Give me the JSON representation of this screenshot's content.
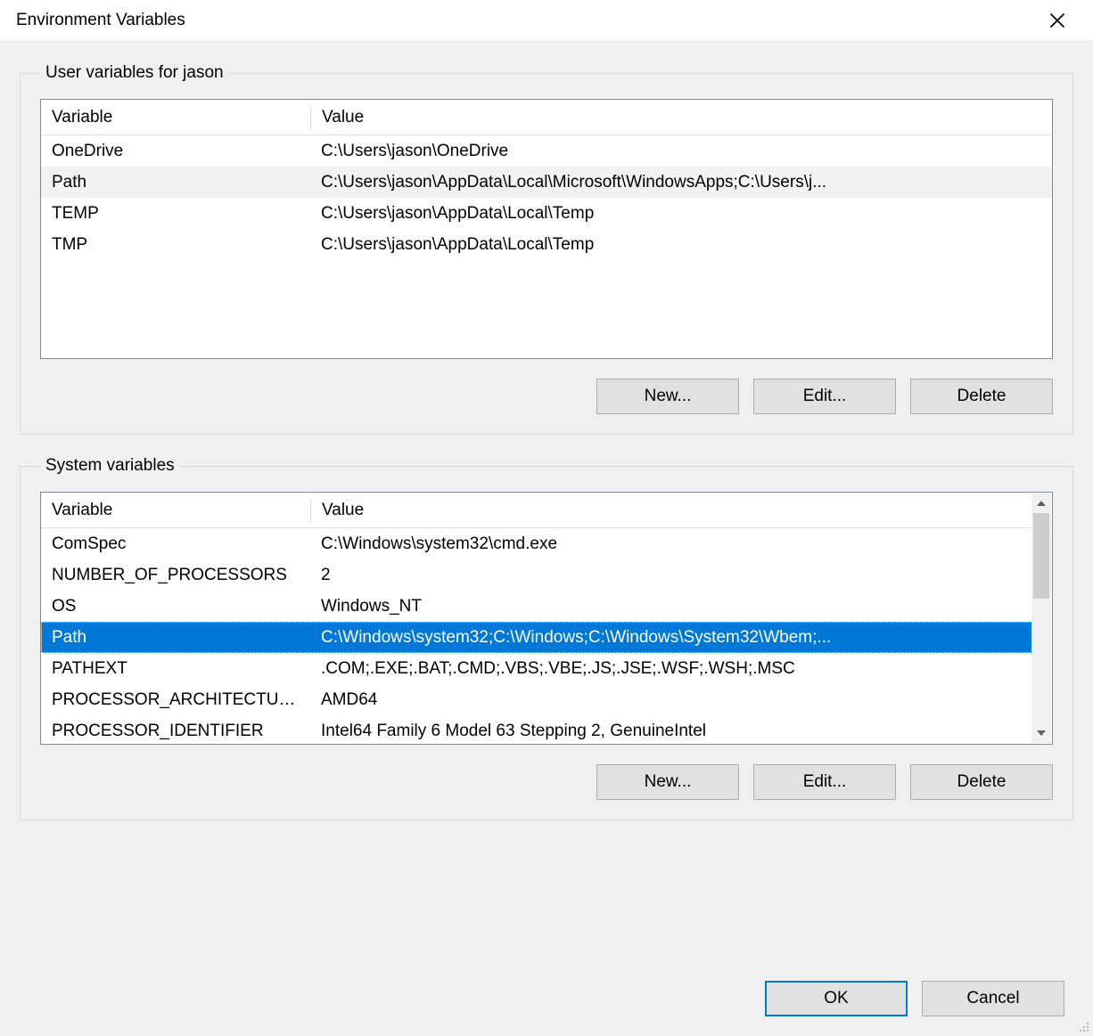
{
  "window": {
    "title": "Environment Variables"
  },
  "columns": {
    "variable": "Variable",
    "value": "Value"
  },
  "user_section": {
    "legend": "User variables for jason",
    "rows": [
      {
        "variable": "OneDrive",
        "value": "C:\\Users\\jason\\OneDrive",
        "selected": false
      },
      {
        "variable": "Path",
        "value": "C:\\Users\\jason\\AppData\\Local\\Microsoft\\WindowsApps;C:\\Users\\j...",
        "selected": "light"
      },
      {
        "variable": "TEMP",
        "value": "C:\\Users\\jason\\AppData\\Local\\Temp",
        "selected": false
      },
      {
        "variable": "TMP",
        "value": "C:\\Users\\jason\\AppData\\Local\\Temp",
        "selected": false
      }
    ],
    "buttons": {
      "new": "New...",
      "edit": "Edit...",
      "delete": "Delete"
    }
  },
  "system_section": {
    "legend": "System variables",
    "rows": [
      {
        "variable": "ComSpec",
        "value": "C:\\Windows\\system32\\cmd.exe",
        "selected": false
      },
      {
        "variable": "NUMBER_OF_PROCESSORS",
        "value": "2",
        "selected": false
      },
      {
        "variable": "OS",
        "value": "Windows_NT",
        "selected": false
      },
      {
        "variable": "Path",
        "value": "C:\\Windows\\system32;C:\\Windows;C:\\Windows\\System32\\Wbem;...",
        "selected": true
      },
      {
        "variable": "PATHEXT",
        "value": ".COM;.EXE;.BAT;.CMD;.VBS;.VBE;.JS;.JSE;.WSF;.WSH;.MSC",
        "selected": false
      },
      {
        "variable": "PROCESSOR_ARCHITECTURE",
        "value": "AMD64",
        "selected": false
      },
      {
        "variable": "PROCESSOR_IDENTIFIER",
        "value": "Intel64 Family 6 Model 63 Stepping 2, GenuineIntel",
        "selected": false
      }
    ],
    "buttons": {
      "new": "New...",
      "edit": "Edit...",
      "delete": "Delete"
    }
  },
  "dialog_buttons": {
    "ok": "OK",
    "cancel": "Cancel"
  }
}
